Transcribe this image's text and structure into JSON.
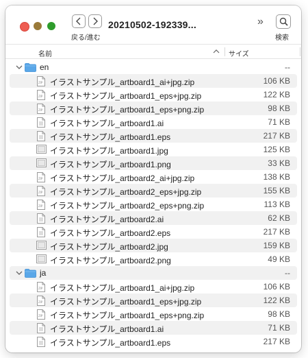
{
  "window": {
    "title": "20210502-192339...",
    "nav_label": "戻る/進む",
    "search_label": "検索",
    "more_glyph": "»"
  },
  "columns": {
    "name": "名前",
    "size": "サイズ"
  },
  "rows": [
    {
      "type": "folder",
      "name": "en",
      "size": "--"
    },
    {
      "type": "file",
      "kind": "zip",
      "name": "イラストサンプル_artboard1_ai+jpg.zip",
      "size": "106 KB"
    },
    {
      "type": "file",
      "kind": "zip",
      "name": "イラストサンプル_artboard1_eps+jpg.zip",
      "size": "122 KB"
    },
    {
      "type": "file",
      "kind": "zip",
      "name": "イラストサンプル_artboard1_eps+png.zip",
      "size": "98 KB"
    },
    {
      "type": "file",
      "kind": "doc",
      "name": "イラストサンプル_artboard1.ai",
      "size": "71 KB"
    },
    {
      "type": "file",
      "kind": "doc",
      "name": "イラストサンプル_artboard1.eps",
      "size": "217 KB"
    },
    {
      "type": "file",
      "kind": "img",
      "name": "イラストサンプル_artboard1.jpg",
      "size": "125 KB"
    },
    {
      "type": "file",
      "kind": "img",
      "name": "イラストサンプル_artboard1.png",
      "size": "33 KB"
    },
    {
      "type": "file",
      "kind": "zip",
      "name": "イラストサンプル_artboard2_ai+jpg.zip",
      "size": "138 KB"
    },
    {
      "type": "file",
      "kind": "zip",
      "name": "イラストサンプル_artboard2_eps+jpg.zip",
      "size": "155 KB"
    },
    {
      "type": "file",
      "kind": "zip",
      "name": "イラストサンプル_artboard2_eps+png.zip",
      "size": "113 KB"
    },
    {
      "type": "file",
      "kind": "doc",
      "name": "イラストサンプル_artboard2.ai",
      "size": "62 KB"
    },
    {
      "type": "file",
      "kind": "doc",
      "name": "イラストサンプル_artboard2.eps",
      "size": "217 KB"
    },
    {
      "type": "file",
      "kind": "img",
      "name": "イラストサンプル_artboard2.jpg",
      "size": "159 KB"
    },
    {
      "type": "file",
      "kind": "img",
      "name": "イラストサンプル_artboard2.png",
      "size": "49 KB"
    },
    {
      "type": "folder",
      "name": "ja",
      "size": "--"
    },
    {
      "type": "file",
      "kind": "zip",
      "name": "イラストサンプル_artboard1_ai+jpg.zip",
      "size": "106 KB"
    },
    {
      "type": "file",
      "kind": "zip",
      "name": "イラストサンプル_artboard1_eps+jpg.zip",
      "size": "122 KB"
    },
    {
      "type": "file",
      "kind": "zip",
      "name": "イラストサンプル_artboard1_eps+png.zip",
      "size": "98 KB"
    },
    {
      "type": "file",
      "kind": "doc",
      "name": "イラストサンプル_artboard1.ai",
      "size": "71 KB"
    },
    {
      "type": "file",
      "kind": "doc",
      "name": "イラストサンプル_artboard1.eps",
      "size": "217 KB"
    }
  ]
}
